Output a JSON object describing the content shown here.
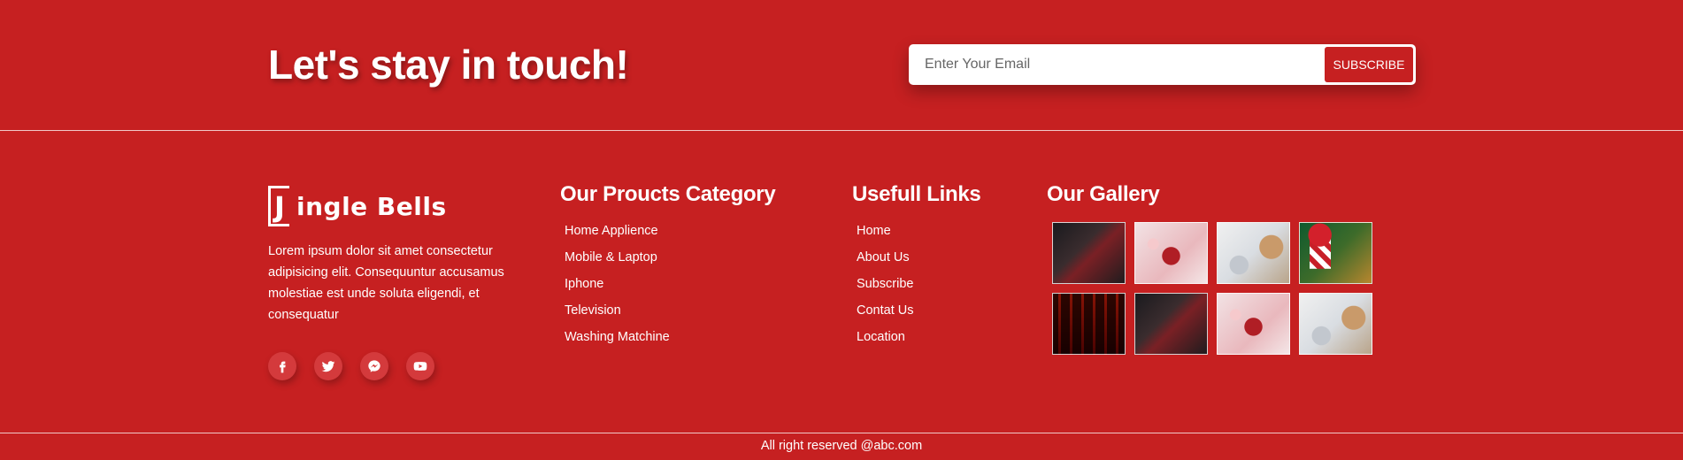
{
  "newsletter": {
    "heading": "Let's stay in touch!",
    "email_placeholder": "Enter Your Email",
    "subscribe_label": "SUBSCRIBE"
  },
  "brand": {
    "logo_initial": "J",
    "logo_text": "ingle Bells",
    "description": "Lorem ipsum dolor sit amet consectetur adipisicing elit. Consequuntur accusamus molestiae est unde soluta eligendi, et consequatur"
  },
  "socials": [
    {
      "icon": "facebook-icon"
    },
    {
      "icon": "twitter-icon"
    },
    {
      "icon": "messenger-icon"
    },
    {
      "icon": "youtube-icon"
    }
  ],
  "products": {
    "heading": "Our Proucts Category",
    "items": [
      "Home Applience",
      "Mobile & Laptop",
      "Iphone",
      "Television",
      "Washing Matchine"
    ]
  },
  "links": {
    "heading": "Usefull Links",
    "items": [
      "Home",
      "About Us",
      "Subscribe",
      "Contat Us",
      "Location"
    ]
  },
  "gallery": {
    "heading": "Our Gallery",
    "images": [
      "christmas-table-photo",
      "gift-bag-photo",
      "wrapped-gifts-photo",
      "christmas-stocking-photo",
      "candles-photo",
      "christmas-table-photo",
      "gift-bag-photo",
      "wrapped-gifts-photo"
    ]
  },
  "footer": {
    "copyright": "All right reserved @abc.com"
  },
  "colors": {
    "background": "#c62021",
    "text": "#ffffff"
  }
}
